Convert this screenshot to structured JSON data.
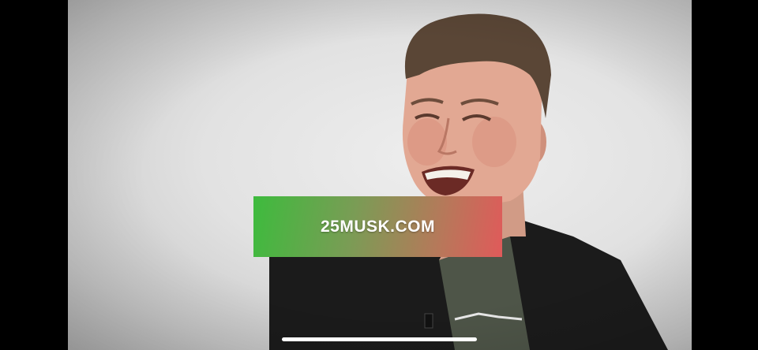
{
  "video": {
    "overlay_text": "25MUSK.COM",
    "banner_colors": [
      "#3dbb3d",
      "#e05a5a"
    ]
  },
  "system": {
    "home_indicator": "home-indicator-bar"
  }
}
